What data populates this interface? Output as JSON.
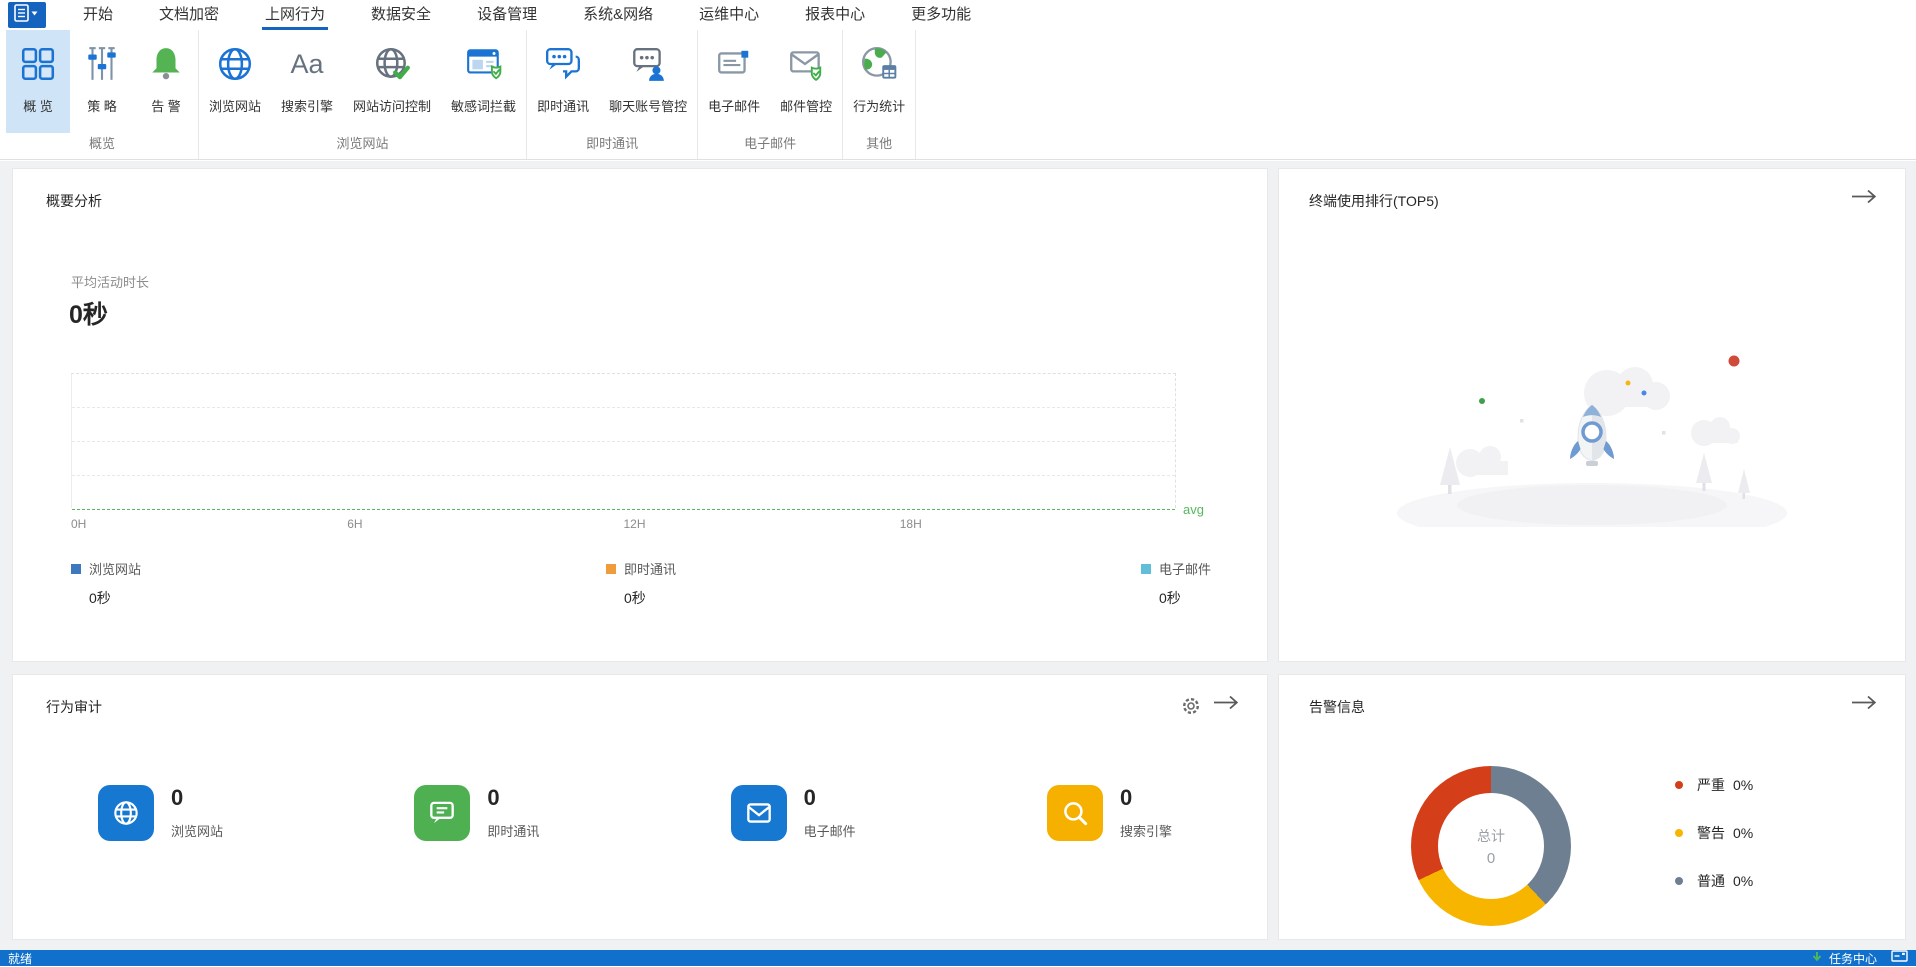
{
  "app_menu": {
    "items": [
      {
        "label": "开始",
        "active": false
      },
      {
        "label": "文档加密",
        "active": false
      },
      {
        "label": "上网行为",
        "active": true
      },
      {
        "label": "数据安全",
        "active": false
      },
      {
        "label": "设备管理",
        "active": false
      },
      {
        "label": "系统&网络",
        "active": false
      },
      {
        "label": "运维中心",
        "active": false
      },
      {
        "label": "报表中心",
        "active": false
      },
      {
        "label": "更多功能",
        "active": false
      }
    ],
    "accent_color": "#1565c0"
  },
  "ribbon": {
    "groups": [
      {
        "label": "概览",
        "items": [
          {
            "label": "概 览",
            "selected": true
          },
          {
            "label": "策 略",
            "selected": false
          },
          {
            "label": "告 警",
            "selected": false
          }
        ]
      },
      {
        "label": "浏览网站",
        "items": [
          {
            "label": "浏览网站",
            "selected": false
          },
          {
            "label": "搜索引擎",
            "selected": false
          },
          {
            "label": "网站访问控制",
            "selected": false
          },
          {
            "label": "敏感词拦截",
            "selected": false
          }
        ]
      },
      {
        "label": "即时通讯",
        "items": [
          {
            "label": "即时通讯",
            "selected": false
          },
          {
            "label": "聊天账号管控",
            "selected": false
          }
        ]
      },
      {
        "label": "电子邮件",
        "items": [
          {
            "label": "电子邮件",
            "selected": false
          },
          {
            "label": "邮件管控",
            "selected": false
          }
        ]
      },
      {
        "label": "其他",
        "items": [
          {
            "label": "行为统计",
            "selected": false
          }
        ]
      }
    ]
  },
  "summary_panel": {
    "title": "概要分析",
    "metric_label": "平均活动时长",
    "metric_value": "0秒",
    "x_ticks": [
      "0H",
      "6H",
      "12H",
      "18H"
    ],
    "avg_label": "avg",
    "avg_color": "#57b75c",
    "legend": [
      {
        "label": "浏览网站",
        "value": "0秒",
        "color": "#4078be"
      },
      {
        "label": "即时通讯",
        "value": "0秒",
        "color": "#f09c3c"
      },
      {
        "label": "电子邮件",
        "value": "0秒",
        "color": "#62bdd8"
      }
    ]
  },
  "top5_panel": {
    "title": "终端使用排行(TOP5)"
  },
  "audit_panel": {
    "title": "行为审计",
    "items": [
      {
        "label": "浏览网站",
        "value": "0",
        "color": "#1778d2"
      },
      {
        "label": "即时通讯",
        "value": "0",
        "color": "#4fb052"
      },
      {
        "label": "电子邮件",
        "value": "0",
        "color": "#1778d2"
      },
      {
        "label": "搜索引擎",
        "value": "0",
        "color": "#f5b000"
      }
    ]
  },
  "alerts_panel": {
    "title": "告警信息",
    "center_label": "总计",
    "center_value": "0",
    "legend": [
      {
        "label": "严重",
        "value": "0%",
        "color": "#d43e19"
      },
      {
        "label": "警告",
        "value": "0%",
        "color": "#f7b500"
      },
      {
        "label": "普通",
        "value": "0%",
        "color": "#6e7f91"
      }
    ]
  },
  "statusbar": {
    "ready": "就绪",
    "task_center": "任务中心"
  },
  "chart_data": [
    {
      "type": "line",
      "panel": "概要分析",
      "title": "平均活动时长",
      "x_ticks": [
        "0H",
        "6H",
        "12H",
        "18H"
      ],
      "annotation_line": {
        "label": "avg",
        "value": 0,
        "color": "#57b75c"
      },
      "series": [
        {
          "name": "浏览网站",
          "total": "0秒",
          "values_note": "all zero, no plotted line"
        },
        {
          "name": "即时通讯",
          "total": "0秒",
          "values_note": "all zero, no plotted line"
        },
        {
          "name": "电子邮件",
          "total": "0秒",
          "values_note": "all zero, no plotted line"
        }
      ]
    },
    {
      "type": "donut",
      "panel": "告警信息",
      "center_label": "总计",
      "center_value": 0,
      "slices": [
        {
          "label": "严重",
          "percent": 0,
          "color": "#d43e19"
        },
        {
          "label": "警告",
          "percent": 0,
          "color": "#f7b500"
        },
        {
          "label": "普通",
          "percent": 0,
          "color": "#6e7f91"
        }
      ],
      "display_segments": [
        {
          "color": "#6e7f91",
          "fraction": 0.38
        },
        {
          "color": "#f7b500",
          "fraction": 0.3
        },
        {
          "color": "#d43e19",
          "fraction": 0.32
        }
      ]
    }
  ]
}
